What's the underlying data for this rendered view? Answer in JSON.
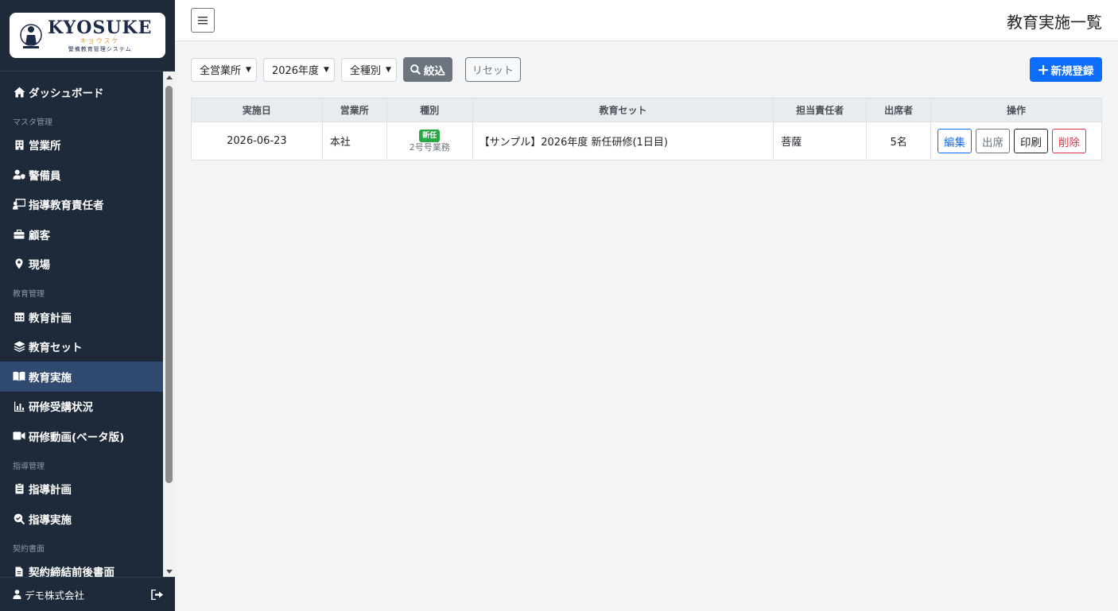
{
  "logo": {
    "title": "KYOSUKE",
    "kana": "キョウスケ",
    "subtitle": "警備教育管理システム"
  },
  "sidebar": {
    "top_items": [
      {
        "label": "ダッシュボード",
        "icon": "home-icon"
      }
    ],
    "sections": [
      {
        "title": "マスタ管理",
        "items": [
          {
            "label": "営業所",
            "icon": "building-icon"
          },
          {
            "label": "警備員",
            "icon": "user-shield-icon"
          },
          {
            "label": "指導教育責任者",
            "icon": "chalkboard-teacher-icon"
          },
          {
            "label": "顧客",
            "icon": "briefcase-icon"
          },
          {
            "label": "現場",
            "icon": "map-pin-icon"
          }
        ]
      },
      {
        "title": "教育管理",
        "items": [
          {
            "label": "教育計画",
            "icon": "calendar-icon"
          },
          {
            "label": "教育セット",
            "icon": "layers-icon"
          },
          {
            "label": "教育実施",
            "icon": "book-open-icon",
            "active": true
          },
          {
            "label": "研修受講状況",
            "icon": "bar-chart-icon"
          },
          {
            "label": "研修動画(ベータ版)",
            "icon": "video-icon"
          }
        ]
      },
      {
        "title": "指導管理",
        "items": [
          {
            "label": "指導計画",
            "icon": "clipboard-icon"
          },
          {
            "label": "指導実施",
            "icon": "search-check-icon"
          }
        ]
      },
      {
        "title": "契約書面",
        "items": [
          {
            "label": "契約締結前後書面",
            "icon": "file-icon"
          }
        ]
      }
    ],
    "footer": {
      "user": "デモ株式会社",
      "logout_icon": "logout-icon"
    }
  },
  "header": {
    "title": "教育実施一覧",
    "menu_icon": "hamburger-icon"
  },
  "filters": {
    "office": "全営業所",
    "year": "2026年度",
    "kind": "全種別",
    "filter_label": "絞込",
    "reset_label": "リセット",
    "new_label": "新規登録"
  },
  "table": {
    "headers": [
      "実施日",
      "営業所",
      "種別",
      "教育セット",
      "担当責任者",
      "出席者",
      "操作"
    ],
    "rows": [
      {
        "date": "2026-06-23",
        "office": "本社",
        "badge": "新任",
        "kind": "2号号業務",
        "set": "【サンプル】2026年度 新任研修(1日目)",
        "responsible": "菩薩",
        "attendees": "5名",
        "actions": {
          "edit": "編集",
          "attend": "出席",
          "print": "印刷",
          "delete": "削除"
        }
      }
    ]
  },
  "colors": {
    "sidebar_bg": "#1e2a3a",
    "active_bg": "#2f4a6e",
    "primary": "#0d6efd",
    "danger": "#dc3545",
    "success": "#28a745"
  }
}
